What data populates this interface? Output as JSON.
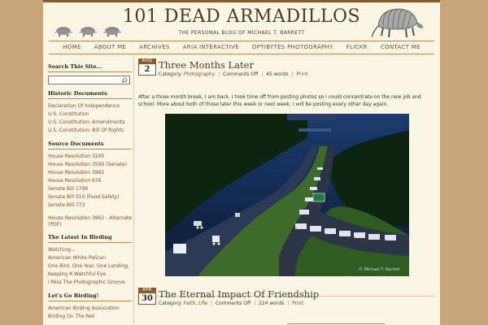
{
  "site": {
    "title": "101 DEAD ARMADILLOS",
    "tagline": "THE PERSONAL BLOG OF MICHAEL T. BARRETT"
  },
  "nav": [
    "HOME",
    "ABOUT ME",
    "ARCHIVES",
    "ARIA INTERACTIVE",
    "OPTIBYTES PHOTOGRAPHY",
    "FLICKR",
    "CONTACT ME"
  ],
  "sidebar": {
    "search_heading": "Search This Site...",
    "search_value": "",
    "historic_heading": "Historic Documents",
    "historic": [
      "Declaration Of Independence",
      "U.S. Constitution",
      "U.S. Constitution: Amendments",
      "U.S. Constitution: Bill Of Rights"
    ],
    "source_heading": "Source Documents",
    "source": [
      "House Resolution 3200",
      "House Resolution 3590 (Senate)",
      "House Resolution 3962",
      "House Resolution 676",
      "Senate Bill 1796",
      "Senate Bill 510 (Food Safety)",
      "Senate Bill 773"
    ],
    "source_last": "House Resolution 3962 - Alternate (PDF)",
    "birding_heading": "The Latest In Birding",
    "birding": [
      "Watching...",
      "American White Pelican",
      "One Bird. One Year. One Landing.",
      "Keeping A Watchful Eye",
      "I Miss The Photographic Groove"
    ],
    "go_heading": "Let's Go Birding!",
    "go": [
      "American Birding Association",
      "Birding On The Net"
    ]
  },
  "posts": [
    {
      "month": "AUG",
      "day": "2",
      "title": "Three Months Later",
      "category_label": "Category:",
      "category": "Photography",
      "comments": "Comments Off",
      "words": "45 words",
      "print": "Print",
      "excerpt": "After a three month break, I am back. I took time off from posting photos so I could concentrate on the new job and school. More about both of those later this week or next week. I will be posting every other day again.",
      "photo_credit": "© Michael T. Barrett"
    },
    {
      "month": "APR",
      "day": "30",
      "title": "The Eternal Impact Of Friendship",
      "category_label": "Category:",
      "category_a": "Faith",
      "category_b": "Life",
      "comments": "Comments Off",
      "words": "224 words",
      "print": "Print"
    }
  ],
  "colors": {
    "background": "#c9a57a",
    "paper": "#fbf5e6",
    "accent": "#8a5a2b",
    "link": "#8a4a1a"
  }
}
